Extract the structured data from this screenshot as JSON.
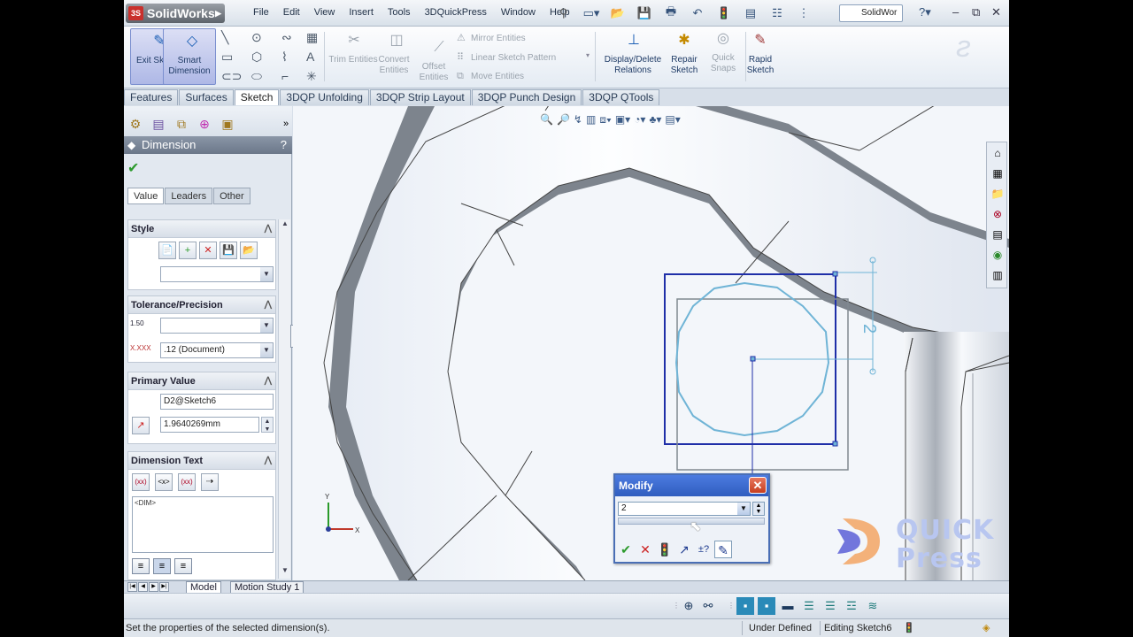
{
  "app": {
    "name": "SolidWorks",
    "badge": "3S"
  },
  "menu": [
    "File",
    "Edit",
    "View",
    "Insert",
    "Tools",
    "3DQuickPress",
    "Window",
    "Help"
  ],
  "search": {
    "value": "SolidWor"
  },
  "ribbon": {
    "exit_sketch": "Exit Sketch",
    "smart_dimension": "Smart Dimension",
    "trim": "Trim Entities",
    "convert": "Convert Entities",
    "offset": "Offset Entities",
    "mirror": "Mirror Entities",
    "linear_pattern": "Linear Sketch Pattern",
    "move": "Move Entities",
    "display_delete": "Display/Delete Relations",
    "repair": "Repair Sketch",
    "quick_snaps": "Quick Snaps",
    "rapid_sketch": "Rapid Sketch"
  },
  "cmd_tabs": [
    "Features",
    "Surfaces",
    "Sketch",
    "3DQP Unfolding",
    "3DQP Strip Layout",
    "3DQP Punch Design",
    "3DQP QTools"
  ],
  "cmd_tab_active": "Sketch",
  "panel": {
    "title": "Dimension",
    "help": "?",
    "tabs": [
      "Value",
      "Leaders",
      "Other"
    ],
    "active_tab": "Value",
    "style": {
      "header": "Style"
    },
    "tolerance": {
      "header": "Tolerance/Precision",
      "tol_icon": "1.50",
      "precision": ".12 (Document)",
      "prec_icon": "X.XXX"
    },
    "primary": {
      "header": "Primary Value",
      "name": "D2@Sketch6",
      "value": "1.9640269mm"
    },
    "dimtext": {
      "header": "Dimension Text",
      "text": "<DIM>",
      "btns": [
        "(xx)",
        "<x>",
        "(xx)"
      ]
    }
  },
  "viewport": {
    "dim_label": "2",
    "triad_y": "Y",
    "triad_x": "X"
  },
  "modify": {
    "title": "Modify",
    "value": "2"
  },
  "bottom_tabs": [
    "Model",
    "Motion Study 1"
  ],
  "bottom_tab_active": "Model",
  "status": {
    "left": "Set the properties of the selected dimension(s).",
    "state": "Under Defined",
    "editing": "Editing Sketch6"
  },
  "watermark": {
    "line1": "QUICK",
    "line2": "Press"
  },
  "colors": {
    "sketch_blue": "#1f2fa8",
    "sketch_cyan": "#6fb4d6",
    "accent": "#2f5dbf"
  }
}
